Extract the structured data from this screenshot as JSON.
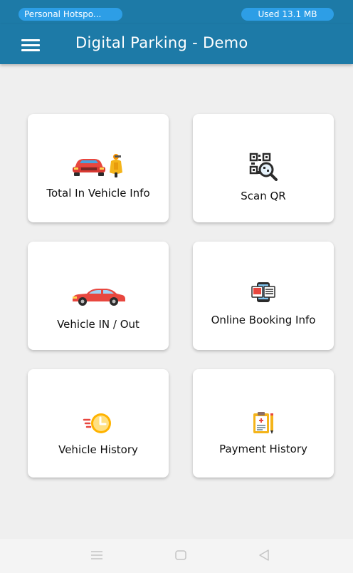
{
  "status_bar": {
    "hotspot": "Personal Hotspo...",
    "data_used": "Used  13.1 MB"
  },
  "app_bar": {
    "title": "Digital Parking - Demo",
    "menu_icon": "hamburger-menu-icon"
  },
  "tiles": [
    {
      "label": "Total In Vehicle Info",
      "icon": "car-and-scooter-icon"
    },
    {
      "label": "Scan QR",
      "icon": "qr-scan-icon"
    },
    {
      "label": "Vehicle IN / Out",
      "icon": "car-icon"
    },
    {
      "label": "Online Booking Info",
      "icon": "online-booking-icon"
    },
    {
      "label": "Vehicle History",
      "icon": "clock-history-icon"
    },
    {
      "label": "Payment History",
      "icon": "clipboard-payment-icon"
    }
  ],
  "nav_bar": {
    "icons": [
      "recents-icon",
      "home-icon",
      "back-icon"
    ]
  },
  "colors": {
    "primary": "#1d7aa7",
    "pill": "#2d9ee6",
    "background": "#efefef"
  }
}
